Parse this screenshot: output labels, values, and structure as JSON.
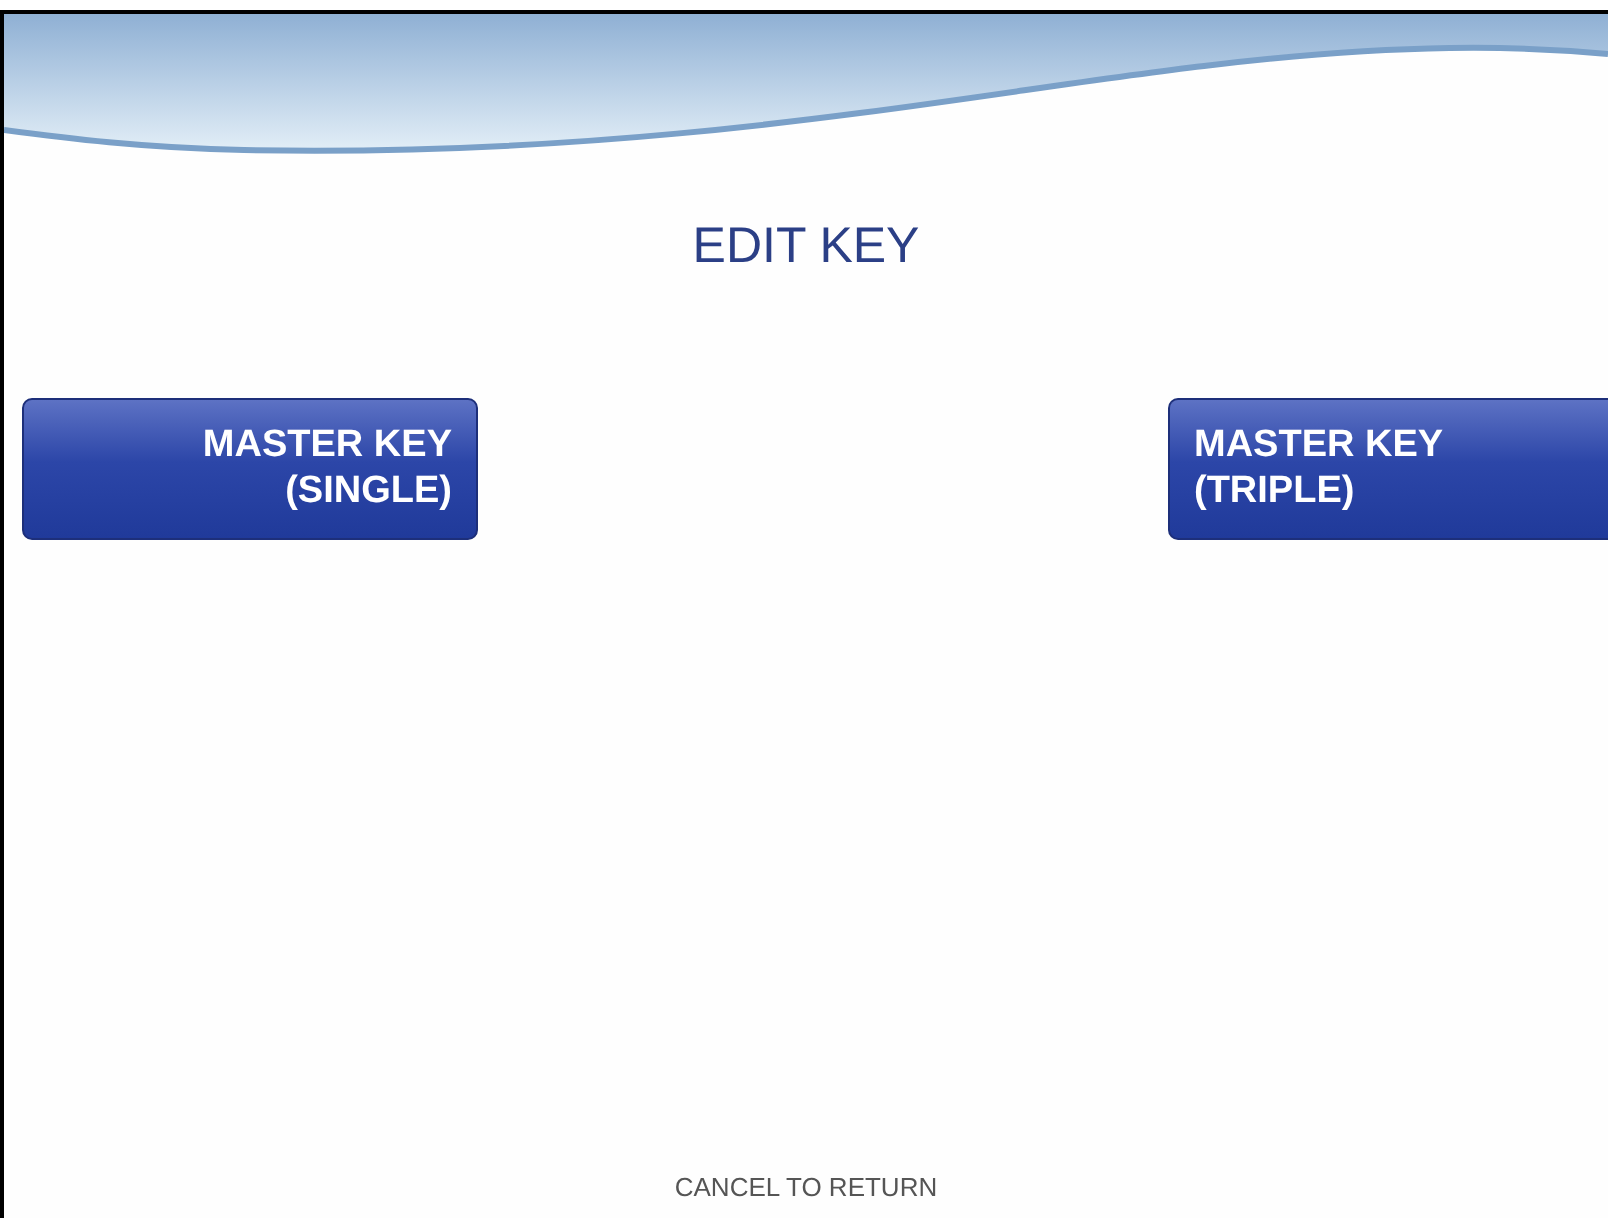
{
  "screen": {
    "title": "EDIT KEY"
  },
  "buttons": [
    {
      "line1": "MASTER KEY",
      "line2": "(SINGLE)",
      "kind": "left"
    },
    {
      "line1": "MASTER KEY",
      "line2": "(TRIPLE)",
      "kind": "right"
    }
  ],
  "footer": {
    "hint": "CANCEL TO RETURN"
  }
}
